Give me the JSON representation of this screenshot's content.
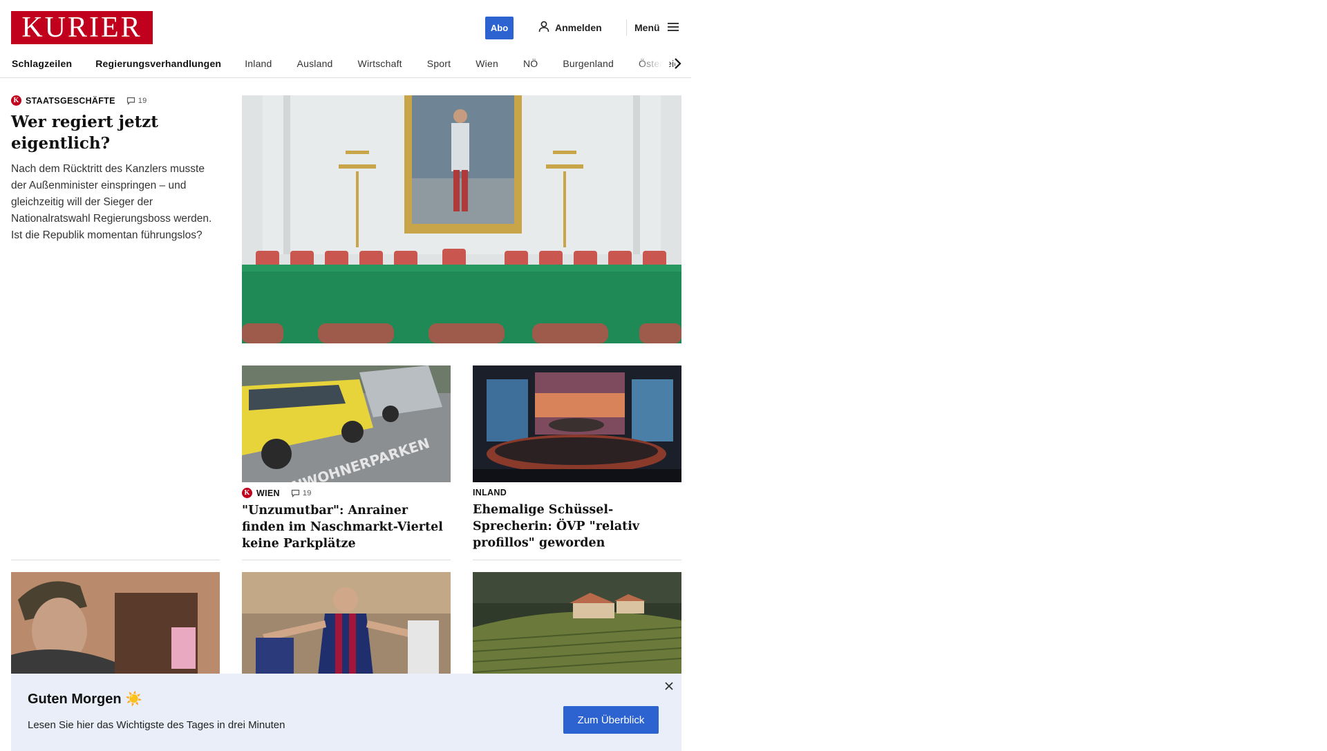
{
  "header": {
    "logo_text": "KURIER",
    "abo_label": "Abo",
    "login_label": "Anmelden",
    "menu_label": "Menü"
  },
  "nav": {
    "items": [
      {
        "label": "Schlagzeilen"
      },
      {
        "label": "Regierungsverhandlungen"
      },
      {
        "label": "Inland"
      },
      {
        "label": "Ausland"
      },
      {
        "label": "Wirtschaft"
      },
      {
        "label": "Sport"
      },
      {
        "label": "Wien"
      },
      {
        "label": "NÖ"
      },
      {
        "label": "Burgenland"
      },
      {
        "label": "Österreich"
      }
    ]
  },
  "lead": {
    "kicker": "STAATSGESCHÄFTE",
    "comments": "19",
    "title": "Wer regiert jetzt eigentlich?",
    "teaser": "Nach dem Rücktritt des Kanzlers musste der Außenminister einspringen – und gleichzeitig will der Sieger der Nationalratswahl Regierungsboss werden. Ist die Republik momentan führungslos?"
  },
  "articles": [
    {
      "kicker": "WIEN",
      "comments": "19",
      "title": "\"Unzumutbar\": Anrainer finden im Naschmarkt-Viertel keine Parkplätze",
      "image_text": "ANWOHNERPARKEN"
    },
    {
      "kicker": "INLAND",
      "title": "Ehemalige Schüssel-Sprecherin: ÖVP \"relativ profillos\" geworden"
    }
  ],
  "banner": {
    "title": "Guten Morgen ☀️",
    "subtitle": "Lesen Sie hier das Wichtigste des Tages in drei Minuten",
    "button_label": "Zum Überblick"
  },
  "colors": {
    "brand_red": "#c0001d",
    "accent_blue": "#2c63d1",
    "banner_bg": "#e9eef8"
  }
}
